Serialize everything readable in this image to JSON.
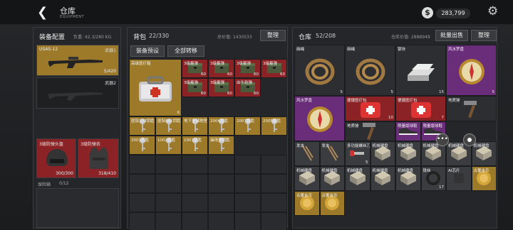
{
  "header": {
    "title": "仓库",
    "subtitle": "EQUIPMENT",
    "money": "283,799"
  },
  "equipment": {
    "title": "装备配置",
    "load": "负重: 42.3/280 KG",
    "weapon1": {
      "name": "USAS-12",
      "slot": "武器1",
      "ammo": "5/420"
    },
    "weapon2": {
      "slot": "武器2"
    },
    "helmet": {
      "name": "3级防弹头盔",
      "value": "300/300"
    },
    "vest": {
      "name": "3级防弹衣",
      "value": "318/410"
    },
    "safebox": {
      "label": "保险箱",
      "count": "0/12"
    }
  },
  "backpack": {
    "title": "背包",
    "count": "22/330",
    "total": "总价值: 1430533",
    "sort": "整理",
    "preset": "装备预设",
    "transfer": "全部转移",
    "items": [
      {
        "name": "高级医疗箱",
        "qty": "6",
        "color": "gold",
        "icon": "medkit-icon"
      },
      {
        "name": "3级霰弹",
        "qty": "60",
        "color": "red",
        "icon": "ammo-box-icon"
      },
      {
        "name": "3级霰弹",
        "qty": "60",
        "color": "red",
        "icon": "ammo-box-icon"
      },
      {
        "name": "3级霰弹",
        "qty": "60",
        "color": "red",
        "icon": "ammo-box-icon"
      },
      {
        "name": "3级霰弹",
        "qty": "60",
        "color": "red",
        "icon": "ammo-box-icon"
      },
      {
        "name": "3级霰弹",
        "qty": "60",
        "color": "red",
        "icon": "ammo-box-icon"
      },
      {
        "name": "3级霰弹",
        "qty": "60",
        "color": "red",
        "icon": "ammo-box-icon"
      },
      {
        "name": "由牛软弹",
        "qty": "60",
        "color": "red",
        "icon": "ammo-box-icon"
      },
      {
        "name": "医院103钥匙",
        "qty": "",
        "color": "gold",
        "icon": "key-icon"
      },
      {
        "name": "医院041钥匙",
        "qty": "",
        "color": "gold",
        "icon": "key-icon"
      },
      {
        "name": "地下室储物室钥匙",
        "qty": "",
        "color": "gold",
        "icon": "key-icon"
      },
      {
        "name": "2004钥匙",
        "qty": "",
        "color": "gold",
        "icon": "key-icon"
      },
      {
        "name": "2007钥匙",
        "qty": "",
        "color": "gold",
        "icon": "key-icon"
      },
      {
        "name": "2005钥匙",
        "qty": "",
        "color": "gold",
        "icon": "key-icon"
      },
      {
        "name": "2001钥匙",
        "qty": "",
        "color": "gold",
        "icon": "key-icon"
      },
      {
        "name": "1002钥匙",
        "qty": "",
        "color": "gold",
        "icon": "key-icon"
      },
      {
        "name": "1001钥匙",
        "qty": "",
        "color": "gold",
        "icon": "key-icon"
      },
      {
        "name": "操场室钥匙",
        "qty": "",
        "color": "gold",
        "icon": "key-icon"
      }
    ]
  },
  "warehouse": {
    "title": "仓库",
    "count": "52/208",
    "total": "仓库价值: 2888949",
    "sell": "批量出售",
    "sort": "整理",
    "items": [
      {
        "name": "麻绳",
        "qty": "5",
        "color": "dark",
        "icon": "rope-icon"
      },
      {
        "name": "麻绳",
        "qty": "5",
        "color": "dark",
        "icon": "rope-icon"
      },
      {
        "name": "银块",
        "qty": "15",
        "color": "dark",
        "icon": "silver-bar-icon"
      },
      {
        "name": "风水罗盘",
        "qty": "5",
        "color": "purple",
        "icon": "compass-icon"
      },
      {
        "name": "风水罗盘",
        "qty": "",
        "color": "purple",
        "icon": "compass-icon"
      },
      {
        "name": "便捷医疗包",
        "qty": "10",
        "color": "red",
        "icon": "medpack-icon"
      },
      {
        "name": "便捷医疗包",
        "qty": "7",
        "color": "red",
        "icon": "medpack-icon"
      },
      {
        "name": "地质锤",
        "qty": "",
        "color": "dark",
        "icon": "hammer-icon"
      },
      {
        "name": "地质锤",
        "qty": "",
        "color": "dark",
        "icon": "hammer-icon"
      },
      {
        "name": "限量版球鞋",
        "qty": "",
        "color": "purple",
        "icon": "sneaker-icon"
      },
      {
        "name": "限量版球鞋",
        "qty": "",
        "color": "purple",
        "icon": "sneaker-icon"
      },
      {
        "name": "发夹",
        "qty": "",
        "color": "gray",
        "icon": "hairpin-icon"
      },
      {
        "name": "发夹",
        "qty": "",
        "color": "gray",
        "icon": "hairpin-icon"
      },
      {
        "name": "多功能螺丝刀",
        "qty": "5",
        "color": "gray",
        "icon": "screwdriver-icon"
      },
      {
        "name": "机械硬盘",
        "qty": "",
        "color": "gray",
        "icon": "hdd-icon"
      },
      {
        "name": "机械硬盘",
        "qty": "",
        "color": "gray",
        "icon": "hdd-icon"
      },
      {
        "name": "机械硬盘",
        "qty": "",
        "color": "gray",
        "icon": "hdd-icon"
      },
      {
        "name": "机械硬盘",
        "qty": "",
        "color": "gray",
        "icon": "hdd-icon"
      },
      {
        "name": "机械硬盘",
        "qty": "",
        "color": "gray",
        "icon": "hdd-icon"
      },
      {
        "name": "机械硬盘",
        "qty": "",
        "color": "gray",
        "icon": "hdd-icon"
      },
      {
        "name": "机械硬盘",
        "qty": "",
        "color": "gray",
        "icon": "hdd-icon"
      },
      {
        "name": "机械硬盘",
        "qty": "",
        "color": "gray",
        "icon": "hdd-icon"
      },
      {
        "name": "机械硬盘",
        "qty": "",
        "color": "gray",
        "icon": "hdd-icon"
      },
      {
        "name": "机械硬盘",
        "qty": "",
        "color": "gray",
        "icon": "hdd-icon"
      },
      {
        "name": "铁丝",
        "qty": "17",
        "color": "gray",
        "icon": "wire-icon"
      },
      {
        "name": "AI芯片",
        "qty": "",
        "color": "gray",
        "icon": "chip-icon"
      },
      {
        "name": "古董金币",
        "qty": "",
        "color": "gold",
        "icon": "coin-icon"
      },
      {
        "name": "古董金币",
        "qty": "",
        "color": "gold",
        "icon": "coin-icon"
      },
      {
        "name": "古董金币",
        "qty": "",
        "color": "gold",
        "icon": "coin-icon"
      }
    ]
  }
}
